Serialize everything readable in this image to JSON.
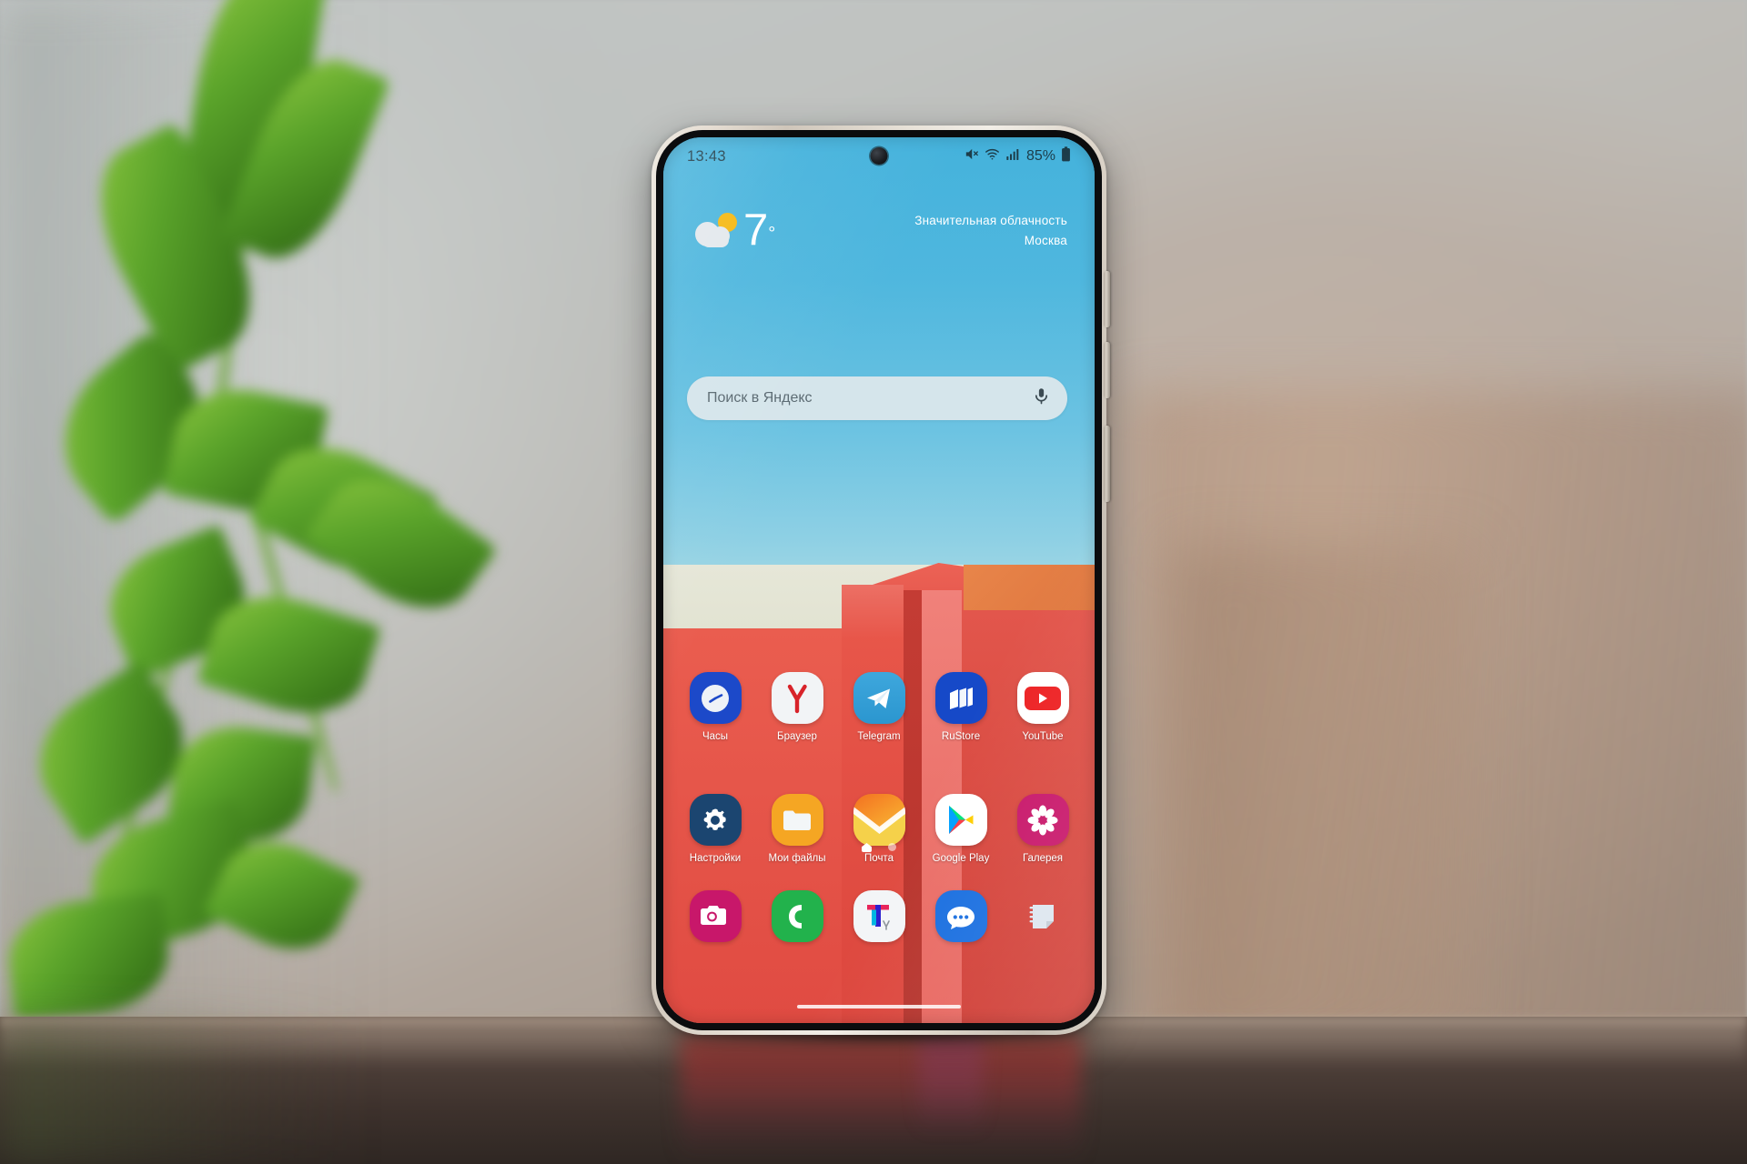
{
  "scene": {
    "description": "Smartphone on wooden table with blurred plant and wall background",
    "device": "Samsung Galaxy smartphone"
  },
  "statusbar": {
    "time": "13:43",
    "battery_percent": "85%",
    "icons": [
      "mute-icon",
      "wifi-icon",
      "signal-icon",
      "battery-icon"
    ]
  },
  "weather": {
    "temperature": "7",
    "degree_symbol": "°",
    "condition": "Значительная облачность",
    "city": "Москва",
    "icon": "partly-cloudy-icon"
  },
  "search": {
    "placeholder": "Поиск в Яндекс",
    "mic_icon": "microphone-icon"
  },
  "homescreen": {
    "row1": [
      {
        "label": "Часы",
        "icon": "clock-icon"
      },
      {
        "label": "Браузер",
        "icon": "yandex-browser-icon"
      },
      {
        "label": "Telegram",
        "icon": "telegram-icon"
      },
      {
        "label": "RuStore",
        "icon": "rustore-icon"
      },
      {
        "label": "YouTube",
        "icon": "youtube-icon"
      }
    ],
    "row2": [
      {
        "label": "Настройки",
        "icon": "settings-gear-icon"
      },
      {
        "label": "Мои файлы",
        "icon": "folder-icon"
      },
      {
        "label": "Почта",
        "icon": "mail-envelope-icon"
      },
      {
        "label": "Google Play",
        "icon": "google-play-icon"
      },
      {
        "label": "Галерея",
        "icon": "gallery-flower-icon"
      }
    ],
    "dock": [
      {
        "label": "",
        "icon": "camera-icon"
      },
      {
        "label": "",
        "icon": "phone-handset-icon"
      },
      {
        "label": "",
        "icon": "yandex-telemost-icon"
      },
      {
        "label": "",
        "icon": "messages-bubble-icon"
      },
      {
        "label": "",
        "icon": "notes-icon"
      }
    ],
    "page_indicator": {
      "pages": 2,
      "current": 1
    },
    "home_gesture_bar": "home-bar"
  },
  "colors": {
    "sky": "#4fb7de",
    "wallpaper_red": "#e0483f",
    "wallpaper_cream": "#e4e5d5",
    "wallpaper_orange": "#e07840",
    "phone_frame": "#e5ddd2",
    "status_text": "#1d3d4a"
  }
}
